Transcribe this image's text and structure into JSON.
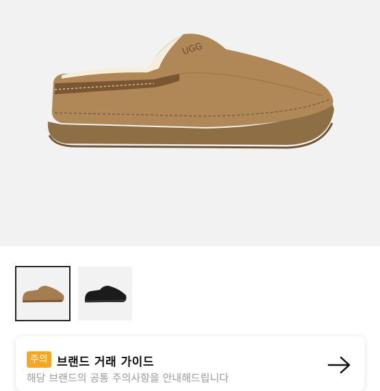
{
  "product": {
    "main_image": "ugg-slipper-chestnut",
    "thumbnails": [
      {
        "name": "ugg-slipper-chestnut",
        "selected": true
      },
      {
        "name": "ugg-slipper-black",
        "selected": false
      }
    ]
  },
  "guide": {
    "badge": "주의",
    "title": "브랜드 거래 가이드",
    "description": "해당 브랜드의 공통 주의사항을 안내해드립니다",
    "arrow_icon": "arrow-right-icon"
  },
  "colors": {
    "badge": "#f5a623",
    "suede": "#a67c52",
    "sole": "#8d6e45",
    "shearling": "#f6eedc"
  }
}
